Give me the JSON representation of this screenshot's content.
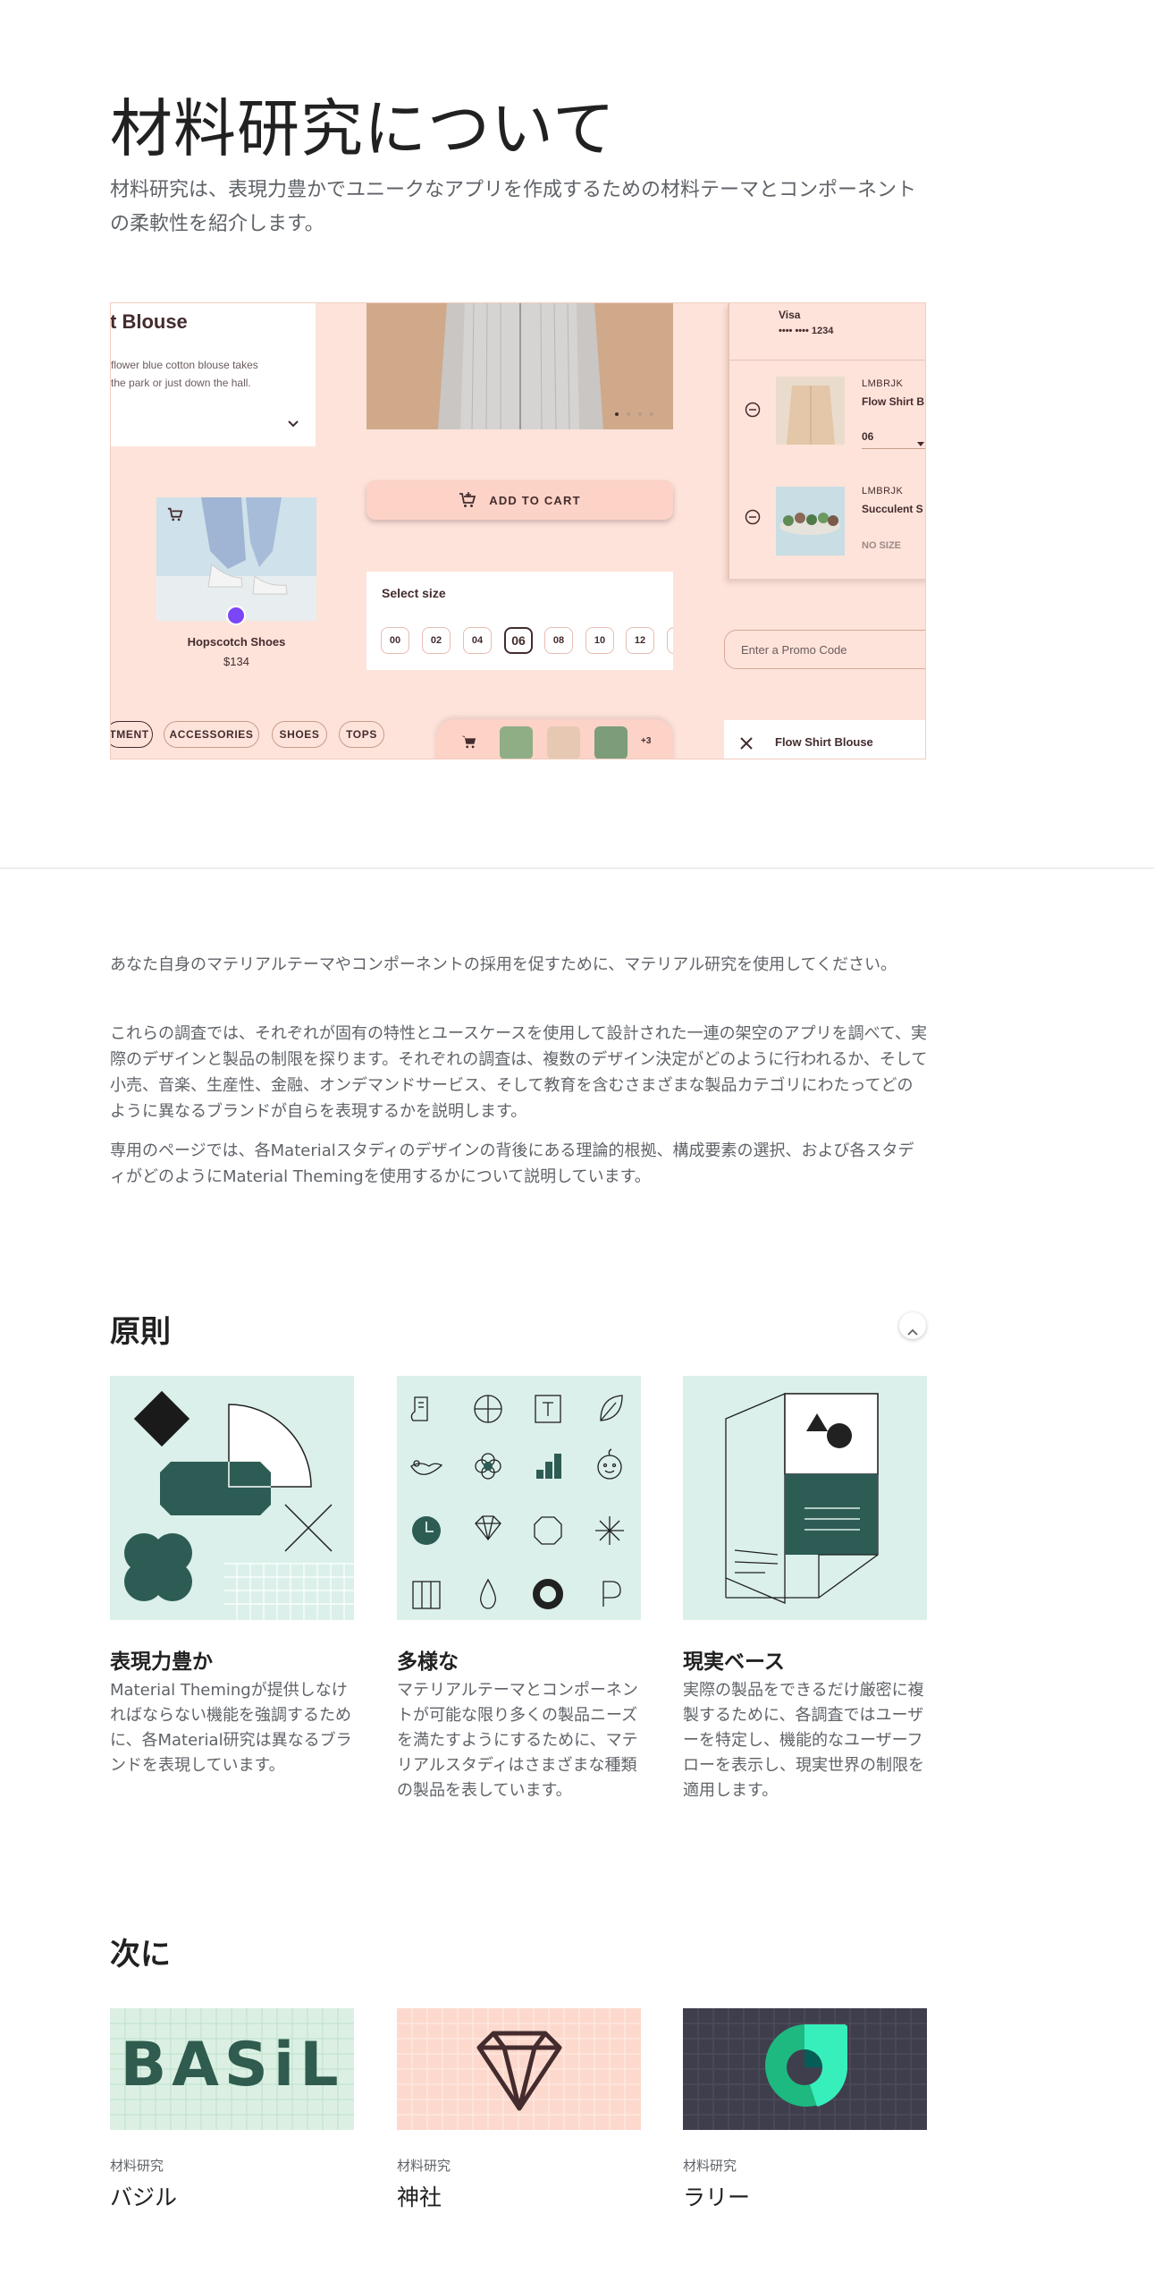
{
  "header": {
    "title": "材料研究について",
    "subtitle": "材料研究は、表現力豊かでユニークなアプリを作成するための材料テーマとコンポーネントの柔軟性を紹介します。"
  },
  "hero": {
    "blouse_title": "t Blouse",
    "blouse_desc_1": "flower blue cotton blouse takes",
    "blouse_desc_2": "the park or just down the hall.",
    "product_name": "Hopscotch Shoes",
    "product_price": "$134",
    "add_to_cart": "ADD TO CART",
    "select_size": "Select size",
    "sizes": [
      "00",
      "02",
      "04",
      "06",
      "08",
      "10",
      "12"
    ],
    "selected_size": "06",
    "card_brand": "Visa",
    "card_number": "•••• •••• 1234",
    "cart_items": [
      {
        "brand": "LMBRJK",
        "name": "Flow Shirt B",
        "size": "06"
      },
      {
        "brand": "LMBRJK",
        "name": "Succulent S",
        "size": "NO SIZE"
      }
    ],
    "promo_placeholder": "Enter a Promo Code",
    "chips": [
      "TMENT",
      "ACCESSORIES",
      "SHOES",
      "TOPS"
    ],
    "cart_more": "+3",
    "bottom_item": "Flow Shirt Blouse",
    "colors": {
      "bg": "#fde3da",
      "text": "#442c2e",
      "button": "#fcd3c6",
      "accent": "#7b46f6"
    }
  },
  "body": {
    "paragraphs": [
      "あなた自身のマテリアルテーマやコンポーネントの採用を促すために、マテリアル研究を使用してください。",
      "これらの調査では、それぞれが固有の特性とユースケースを使用して設計された一連の架空のアプリを調べて、実際のデザインと製品の制限を探ります。それぞれの調査は、複数のデザイン決定がどのように行われるか、そして小売、音楽、生産性、金融、オンデマンドサービス、そして教育を含むさまざまな製品カテゴリにわたってどのように異なるブランドが自らを表現するかを説明します。",
      "専用のページでは、各Materialスタディのデザインの背後にある理論的根拠、構成要素の選択、および各スタディがどのようにMaterial Themingを使用するかについて説明しています。"
    ]
  },
  "principles": {
    "title": "原則",
    "cards": [
      {
        "title": "表現力豊か",
        "body": "Material Themingが提供しなければならない機能を強調するために、各Material研究は異なるブランドを表現しています。",
        "icon": "shapes-illustration"
      },
      {
        "title": "多様な",
        "body": "マテリアルテーマとコンポーネントが可能な限り多くの製品ニーズを満たすようにするために、マテリアルスタディはさまざまな種類の製品を表しています。",
        "icon": "icon-grid-illustration"
      },
      {
        "title": "現実ベース",
        "body": "実際の製品をできるだけ厳密に複製するために、各調査ではユーザーを特定し、機能的なユーザーフローを表示し、現実世界の制限を適用します。",
        "icon": "perspective-illustration"
      }
    ],
    "colors": {
      "tile": "#dbf0ea",
      "dark": "#2d5c55"
    }
  },
  "next": {
    "title": "次に",
    "items": [
      {
        "category": "材料研究",
        "name": "バジル",
        "logo_text": "BASiL",
        "bg": "#dbf0e3"
      },
      {
        "category": "材料研究",
        "name": "神社",
        "bg": "#fdd9cd"
      },
      {
        "category": "材料研究",
        "name": "ラリー",
        "bg": "#3f3e4d"
      }
    ]
  }
}
